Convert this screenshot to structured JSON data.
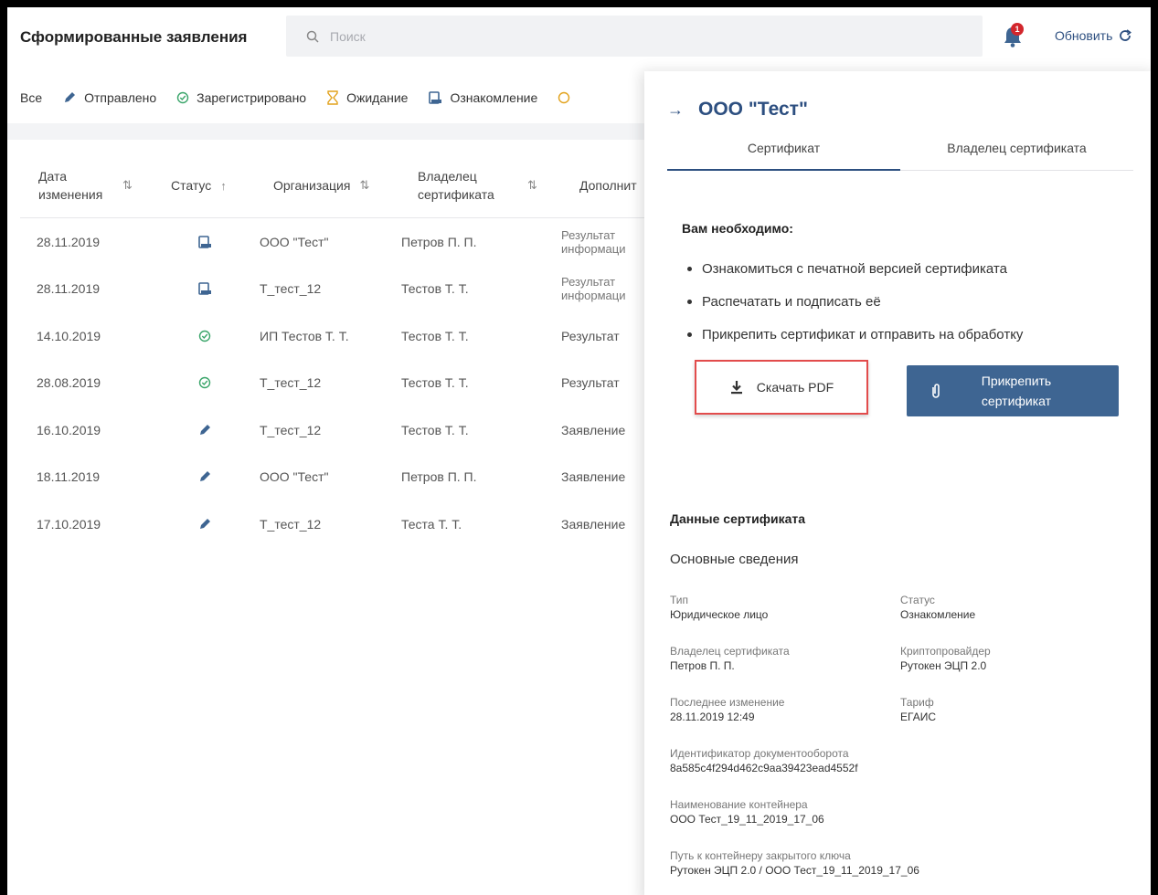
{
  "header": {
    "title": "Сформированные заявления",
    "search_placeholder": "Поиск",
    "notifications_count": "1",
    "refresh_label": "Обновить"
  },
  "filters": [
    {
      "label": "Все",
      "icon": "none"
    },
    {
      "label": "Отправлено",
      "icon": "pencil-icon"
    },
    {
      "label": "Зарегистрировано",
      "icon": "check-circle-icon"
    },
    {
      "label": "Ожидание",
      "icon": "hourglass-icon"
    },
    {
      "label": "Ознакомление",
      "icon": "document-icon"
    }
  ],
  "table": {
    "columns": [
      "Дата изменения",
      "Статус",
      "Организация",
      "Владелец сертификата",
      "Дополнит"
    ],
    "rows": [
      {
        "date": "28.11.2019",
        "status": "document",
        "org": "ООО \"Тест\"",
        "owner": "Петров П. П.",
        "extra": "Результат информаци"
      },
      {
        "date": "28.11.2019",
        "status": "document",
        "org": "Т_тест_12",
        "owner": "Тестов Т. Т.",
        "extra": "Результат информаци"
      },
      {
        "date": "14.10.2019",
        "status": "check",
        "org": "ИП Тестов Т. Т.",
        "owner": "Тестов Т. Т.",
        "extra": "Результат"
      },
      {
        "date": "28.08.2019",
        "status": "check",
        "org": "Т_тест_12",
        "owner": "Тестов Т. Т.",
        "extra": "Результат"
      },
      {
        "date": "16.10.2019",
        "status": "pencil",
        "org": "Т_тест_12",
        "owner": "Тестов Т. Т.",
        "extra": "Заявление"
      },
      {
        "date": "18.11.2019",
        "status": "pencil",
        "org": "ООО \"Тест\"",
        "owner": "Петров П. П.",
        "extra": "Заявление"
      },
      {
        "date": "17.10.2019",
        "status": "pencil",
        "org": "Т_тест_12",
        "owner": "Теста Т. Т.",
        "extra": "Заявление"
      }
    ]
  },
  "panel": {
    "title": "ООО \"Тест\"",
    "tabs": [
      "Сертификат",
      "Владелец сертификата"
    ],
    "need_title": "Вам необходимо:",
    "need_items": [
      "Ознакомиться с печатной версией сертификата",
      "Распечатать и подписать её",
      "Прикрепить сертификат и отправить на обработку"
    ],
    "download_label": "Скачать PDF",
    "attach_label_1": "Прикрепить",
    "attach_label_2": "сертификат",
    "data_title": "Данные сертификата",
    "main_info": "Основные сведения",
    "fields": {
      "type_k": "Тип",
      "type_v": "Юридическое лицо",
      "status_k": "Статус",
      "status_v": "Ознакомление",
      "owner_k": "Владелец сертификата",
      "owner_v": "Петров П. П.",
      "crypto_k": "Криптопровайдер",
      "crypto_v": "Рутокен ЭЦП 2.0",
      "changed_k": "Последнее изменение",
      "changed_v": "28.11.2019 12:49",
      "tariff_k": "Тариф",
      "tariff_v": "ЕГАИС",
      "docflow_k": "Идентификатор документооборота",
      "docflow_v": "8a585c4f294d462c9aa39423ead4552f",
      "container_k": "Наименование контейнера",
      "container_v": "ООО Тест_19_11_2019_17_06",
      "path_k": "Путь к контейнеру закрытого ключа",
      "path_v": "Рутокен ЭЦП 2.0 / ООО Тест_19_11_2019_17_06"
    }
  },
  "colors": {
    "accent": "#2d4f80",
    "button": "#3e6592",
    "highlight": "#e24c4c",
    "badge": "#d2262c"
  }
}
